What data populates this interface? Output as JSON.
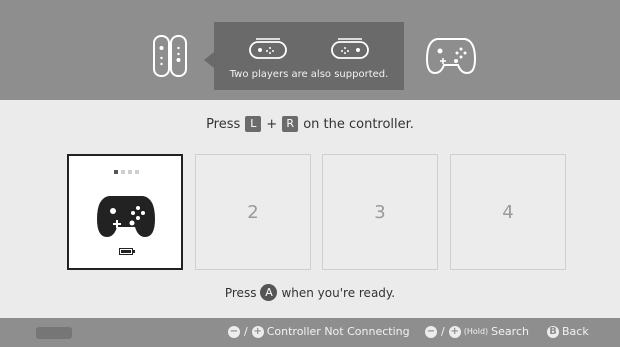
{
  "header": {
    "tooltip_text": "Two players are also supported."
  },
  "instructions": {
    "press_prefix": "Press",
    "key_l": "L",
    "plus": "+",
    "key_r": "R",
    "press_suffix": "on the controller.",
    "ready_prefix": "Press",
    "button_a": "A",
    "ready_suffix": "when you're ready."
  },
  "slots": [
    {
      "label": ""
    },
    {
      "label": "2"
    },
    {
      "label": "3"
    },
    {
      "label": "4"
    }
  ],
  "player_indicator": {
    "active_index": 0,
    "total": 4
  },
  "battery_level": 0.8,
  "footer": {
    "minus": "−",
    "plus": "+",
    "slash": "/",
    "not_connecting_label": "Controller Not Connecting",
    "hold_label": "(Hold)",
    "search_label": "Search",
    "b_button": "B",
    "back_label": "Back"
  }
}
